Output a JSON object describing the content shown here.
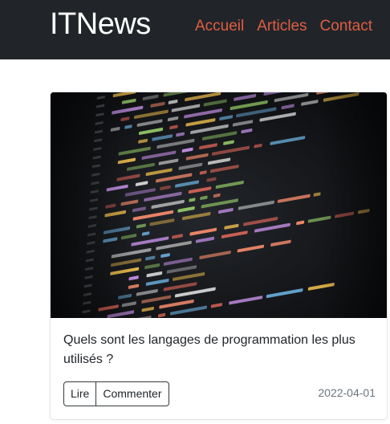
{
  "header": {
    "brand": "ITNews",
    "nav": [
      "Accueil",
      "Articles",
      "Contact"
    ],
    "link_color": "#e05d44",
    "bg_color": "#212529"
  },
  "card": {
    "image_alt_icon": "code-screen-image",
    "title": "Quels sont les langages de programmation les plus utilisés ?",
    "buttons": {
      "read": "Lire",
      "comment": "Commenter"
    },
    "date": "2022-04-01"
  }
}
